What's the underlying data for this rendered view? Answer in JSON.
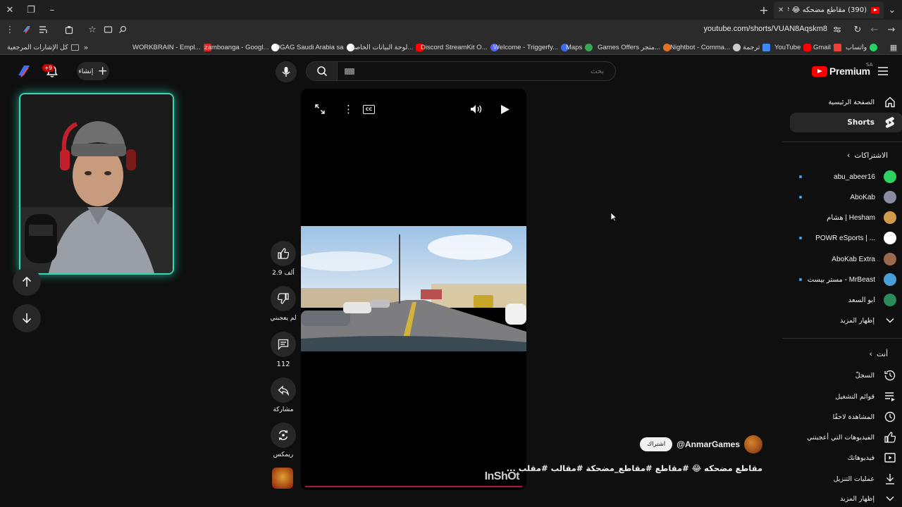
{
  "browser": {
    "tab_title": "(390) مقاطع مضحكه 😂 #مقاطع",
    "url": "youtube.com/shorts/VUAN8Aqskm8",
    "bookmarks": [
      {
        "label": "كل الإشارات المرجعية",
        "color": "#aaaaaa"
      },
      {
        "label": "WORKBRAIN - Empl...",
        "color": "#d12b2b"
      },
      {
        "label": "zamboanga - Googl...",
        "color": "#ffffff"
      },
      {
        "label": "9GAG Saudi Arabia sa",
        "color": "#ffffff"
      },
      {
        "label": "لوحة البيانات الخاصة...",
        "color": "#ff0000"
      },
      {
        "label": "Discord StreamKit O...",
        "color": "#5865f2"
      },
      {
        "label": "Welcome - Triggerfy...",
        "color": "#3b6cf0"
      },
      {
        "label": "Maps",
        "color": "#34a853"
      },
      {
        "label": "Games Offers متجر...",
        "color": "#e0702a"
      },
      {
        "label": "Nightbot - Comma...",
        "color": "#cccccc"
      },
      {
        "label": "ترجمة",
        "color": "#4285f4"
      },
      {
        "label": "YouTube",
        "color": "#ff0000"
      },
      {
        "label": "Gmail",
        "color": "#ea4335"
      },
      {
        "label": "واتساب",
        "color": "#25d366"
      }
    ]
  },
  "header": {
    "brand": "Premium",
    "region": "SA",
    "search_placeholder": "بحث",
    "create_label": "إنشاء",
    "notif_count": "+9"
  },
  "sidebar": {
    "home": "الصفحة الرئيسية",
    "shorts": "Shorts",
    "subscriptions_head": "الاشتراكات",
    "subscriptions": [
      {
        "name": "abu_abeer16",
        "color": "#2fd160",
        "dot": true
      },
      {
        "name": "AboKab",
        "color": "#8a8aa0",
        "dot": true
      },
      {
        "name": "هشام | Hesham",
        "color": "#d19a4a",
        "dot": false
      },
      {
        "name": "POWR eSports | ...",
        "color": "#ffffff",
        "dot": true
      },
      {
        "name": "AboKab Extra",
        "color": "#9a6a4a",
        "dot": false
      },
      {
        "name": "مستر بيست - MrBeast",
        "color": "#4aa0d6",
        "dot": true
      },
      {
        "name": "ابو السعد",
        "color": "#2a8a5a",
        "dot": false
      }
    ],
    "show_more": "إظهار المزيد",
    "you_head": "أنت",
    "you_items": [
      {
        "label": "السجلّ",
        "icon": "history-icon"
      },
      {
        "label": "قوائم التشغيل",
        "icon": "playlist-icon"
      },
      {
        "label": "المشاهدة لاحقًا",
        "icon": "clock-icon"
      },
      {
        "label": "الفيديوهات التي أعجبتني",
        "icon": "thumb-up-icon"
      },
      {
        "label": "فيديوهاتك",
        "icon": "video-icon"
      },
      {
        "label": "عمليات التنزيل",
        "icon": "download-icon"
      }
    ],
    "show_more_2": "إظهار المزيد"
  },
  "short": {
    "likes": "2.9 ألف",
    "dislike": "لم يعجبني",
    "comments": "112",
    "share": "مشاركة",
    "remix": "ريمكس",
    "channel": "@AnmarGames",
    "subscribe": "اشتراك",
    "title": "مقاطع مضحكه 😂 #مقاطع #مقاطع_مضحكة #مقالب #مقلب ...",
    "watermark": "InShOt"
  }
}
